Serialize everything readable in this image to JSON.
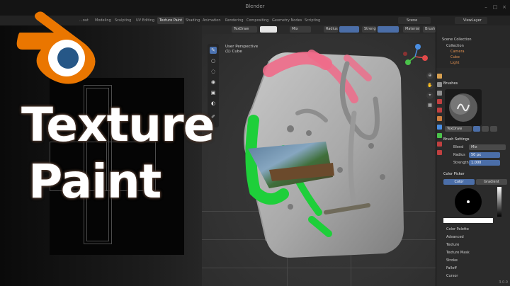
{
  "window": {
    "title": "Blender",
    "controls": [
      "–",
      "□",
      "×"
    ]
  },
  "workspaces": [
    {
      "label": "...out",
      "active": false
    },
    {
      "label": "Modeling",
      "active": false
    },
    {
      "label": "Sculpting",
      "active": false
    },
    {
      "label": "UV Editing",
      "active": false
    },
    {
      "label": "Texture Paint",
      "active": true
    },
    {
      "label": "Shading",
      "active": false
    },
    {
      "label": "Animation",
      "active": false
    },
    {
      "label": "Rendering",
      "active": false
    },
    {
      "label": "Compositing",
      "active": false
    },
    {
      "label": "Geometry Nodes",
      "active": false
    },
    {
      "label": "Scripting",
      "active": false
    }
  ],
  "scene": {
    "name": "Scene",
    "view_layer": "ViewLayer"
  },
  "tool_header": {
    "brush_name": "TexDraw",
    "blend": "Mix",
    "radius_label": "Radius",
    "strength_label": "Strength",
    "texture_slot": "Material",
    "brush_button": "Brush"
  },
  "viewport": {
    "perspective": "User Perspective",
    "object": "(1) Cube"
  },
  "outliner": {
    "title": "Scene Collection",
    "items": [
      "Collection",
      "Camera",
      "Cube",
      "Light"
    ]
  },
  "properties": {
    "brushes_header": "Brushes",
    "brush_name": "TexDraw",
    "brush_settings_header": "Brush Settings",
    "blend_label": "Blend",
    "blend_value": "Mix",
    "radius_label": "Radius",
    "radius_value": "50 px",
    "strength_label": "Strength",
    "strength_value": "1.000",
    "color_picker_header": "Color Picker",
    "color_tab": "Color",
    "gradient_tab": "Gradient",
    "sections": [
      "Color Palette",
      "Advanced",
      "Texture",
      "Texture Mask",
      "Stroke",
      "Falloff",
      "Cursor"
    ]
  },
  "overlay": {
    "line1": "Texture",
    "line2": "Paint",
    "logo": "blender-logo"
  },
  "colors": {
    "accent_blue": "#4b72b0",
    "logo_orange": "#ea7600",
    "logo_blue": "#265787",
    "paint_green": "#1ecf3a",
    "paint_pink": "#f06b8a"
  },
  "version": "3.0.0"
}
